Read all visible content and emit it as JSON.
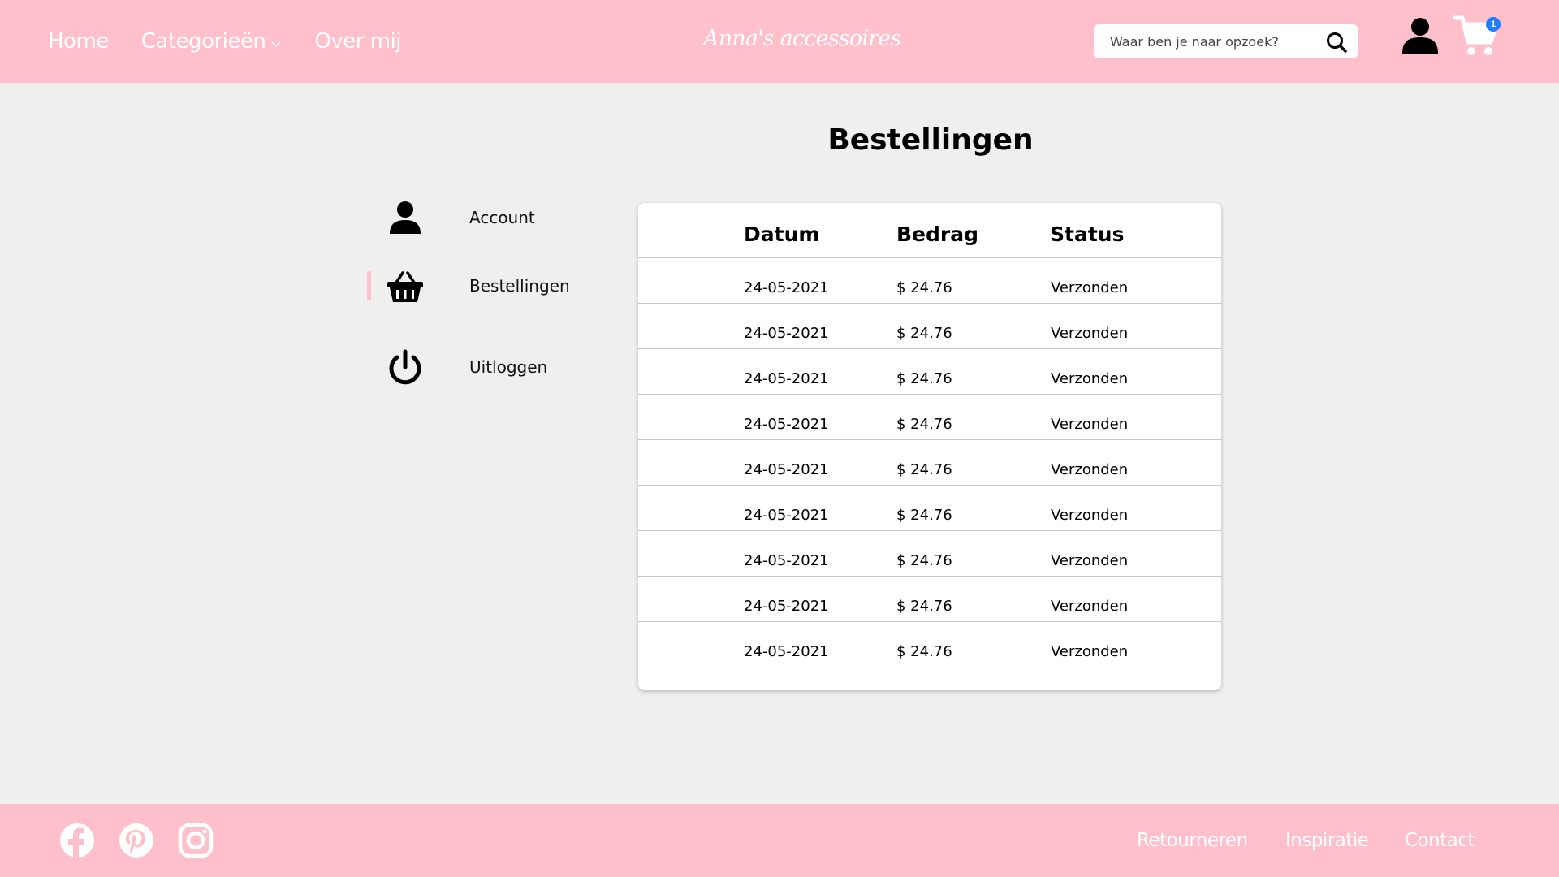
{
  "header": {
    "nav": [
      {
        "label": "Home"
      },
      {
        "label": "Categorieën"
      },
      {
        "label": "Over mij"
      }
    ],
    "brand": "Anna's accessoires",
    "search": {
      "placeholder": "Waar ben je naar opzoek?"
    },
    "cart_count": "1",
    "icons": {
      "search": "search-icon",
      "user": "user-icon",
      "cart": "cart-icon",
      "dropdown": "chevron-down-icon"
    }
  },
  "page_title": "Bestellingen",
  "sidebar": {
    "items": [
      {
        "label": "Account",
        "icon": "user-icon",
        "active": false
      },
      {
        "label": "Bestellingen",
        "icon": "basket-icon",
        "active": true
      },
      {
        "label": "Uitloggen",
        "icon": "power-icon",
        "active": false
      }
    ]
  },
  "orders": {
    "columns": [
      "Datum",
      "Bedrag",
      "Status"
    ],
    "rows": [
      {
        "datum": "24-05-2021",
        "bedrag": "$ 24.76",
        "status": "Verzonden"
      },
      {
        "datum": "24-05-2021",
        "bedrag": "$ 24.76",
        "status": "Verzonden"
      },
      {
        "datum": "24-05-2021",
        "bedrag": "$ 24.76",
        "status": "Verzonden"
      },
      {
        "datum": "24-05-2021",
        "bedrag": "$ 24.76",
        "status": "Verzonden"
      },
      {
        "datum": "24-05-2021",
        "bedrag": "$ 24.76",
        "status": "Verzonden"
      },
      {
        "datum": "24-05-2021",
        "bedrag": "$ 24.76",
        "status": "Verzonden"
      },
      {
        "datum": "24-05-2021",
        "bedrag": "$ 24.76",
        "status": "Verzonden"
      },
      {
        "datum": "24-05-2021",
        "bedrag": "$ 24.76",
        "status": "Verzonden"
      },
      {
        "datum": "24-05-2021",
        "bedrag": "$ 24.76",
        "status": "Verzonden"
      }
    ]
  },
  "footer": {
    "social": [
      {
        "icon": "facebook-icon"
      },
      {
        "icon": "pinterest-icon"
      },
      {
        "icon": "instagram-icon"
      }
    ],
    "links": [
      {
        "label": "Retourneren"
      },
      {
        "label": "Inspiratie"
      },
      {
        "label": "Contact"
      }
    ]
  },
  "colors": {
    "primary_pink": "#ffc0cb",
    "background": "#efefef",
    "badge_blue": "#1f7dff"
  }
}
